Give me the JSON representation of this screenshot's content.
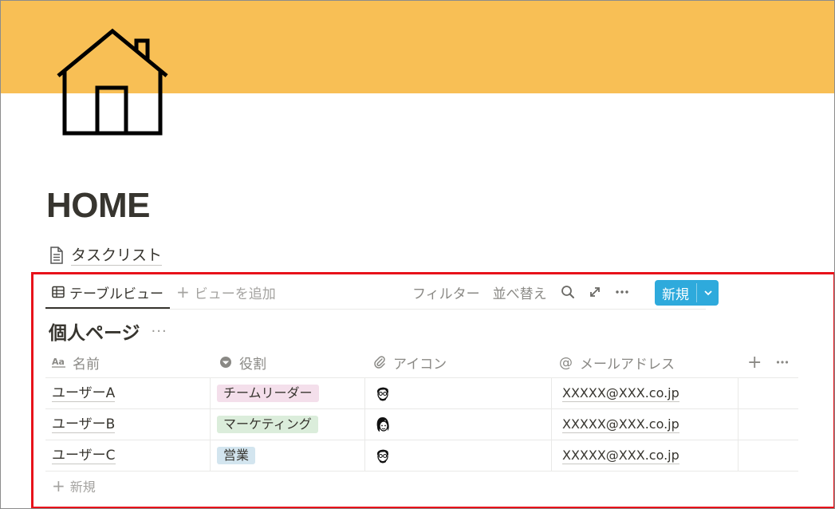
{
  "colors": {
    "cover": "#f8bf55",
    "highlight": "#e8121a",
    "accent": "#2eaadc"
  },
  "page": {
    "icon": "house-icon",
    "title": "HOME",
    "subpage_label": "タスクリスト"
  },
  "viewbar": {
    "active_tab": "テーブルビュー",
    "add_view": "ビューを追加",
    "filter": "フィルター",
    "sort": "並べ替え",
    "new": "新規"
  },
  "database": {
    "title": "個人ページ",
    "columns": [
      {
        "label": "名前",
        "icon": "text-aa-icon"
      },
      {
        "label": "役割",
        "icon": "select-icon"
      },
      {
        "label": "アイコン",
        "icon": "paperclip-icon"
      },
      {
        "label": "メールアドレス",
        "icon": "at-icon"
      }
    ],
    "rows": [
      {
        "name": "ユーザーA",
        "role": "チームリーダー",
        "role_color": "#f4dfeb",
        "avatar": "avatar-man-glasses-icon",
        "email": "XXXXX@XXX.co.jp"
      },
      {
        "name": "ユーザーB",
        "role": "マーケティング",
        "role_color": "#dbeddb",
        "avatar": "avatar-woman-icon",
        "email": "XXXXX@XXX.co.jp"
      },
      {
        "name": "ユーザーC",
        "role": "営業",
        "role_color": "#d3e5ef",
        "avatar": "avatar-man-glasses-icon",
        "email": "XXXXX@XXX.co.jp"
      }
    ],
    "new_row": "新規"
  }
}
